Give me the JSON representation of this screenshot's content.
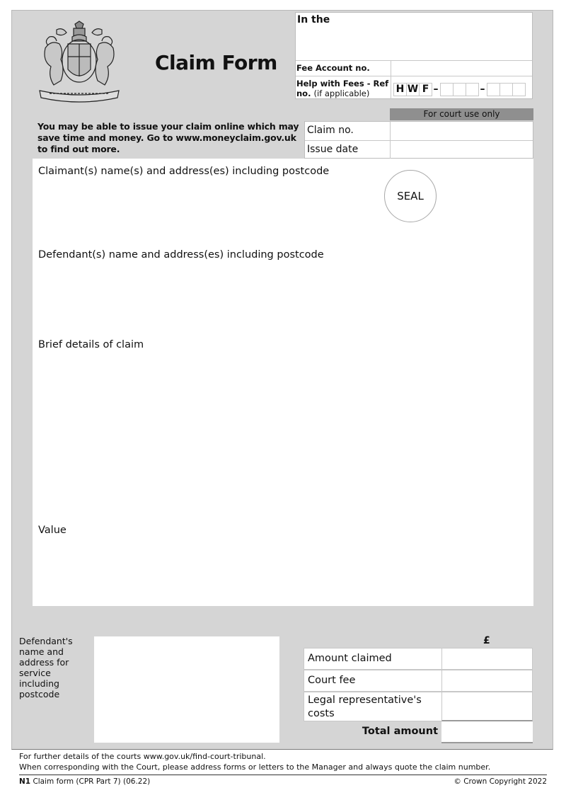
{
  "form": {
    "title": "Claim Form",
    "crest_icon": "royal-coat-of-arms",
    "online_note": "You may be able to issue your claim online which may save time and money. Go to www.moneyclaim.gov.uk to find out more."
  },
  "header_box": {
    "in_the_label": "In the",
    "in_the_value": "",
    "fee_account_label": "Fee Account no.",
    "fee_account_value": "",
    "hwf_label_bold": "Help with Fees - Ref no.",
    "hwf_label_normal": "(if applicable)",
    "hwf_prefix": [
      "H",
      "W",
      "F"
    ],
    "hwf_dash": "–",
    "hwf_group1": [
      "",
      "",
      ""
    ],
    "hwf_group2": [
      "",
      "",
      ""
    ]
  },
  "court_use": {
    "banner": "For court use only",
    "rows": [
      {
        "label": "Claim no.",
        "value": ""
      },
      {
        "label": "Issue date",
        "value": ""
      }
    ]
  },
  "main": {
    "claimant_label": "Claimant(s) name(s) and address(es) including postcode",
    "claimant_value": "",
    "seal_label": "SEAL",
    "defendant_label": "Defendant(s) name and address(es) including postcode",
    "defendant_value": "",
    "details_label": "Brief details of claim",
    "details_value": "",
    "value_label": "Value",
    "value_value": ""
  },
  "service": {
    "label": "Defendant's name and address for service including postcode",
    "value": ""
  },
  "amounts": {
    "currency_symbol": "£",
    "rows": [
      {
        "label": "Amount claimed",
        "value": ""
      },
      {
        "label": "Court fee",
        "value": ""
      },
      {
        "label": "Legal representative's costs",
        "value": ""
      },
      {
        "label": "Total amount",
        "value": ""
      }
    ]
  },
  "footer": {
    "line1": "For further details of the courts www.gov.uk/find-court-tribunal.",
    "line2": "When corresponding with the Court, please address forms or letters to the Manager and always quote the claim number.",
    "form_code": "N1",
    "form_desc": "Claim form (CPR Part 7) (06.22)",
    "copyright": "© Crown Copyright 2022"
  }
}
